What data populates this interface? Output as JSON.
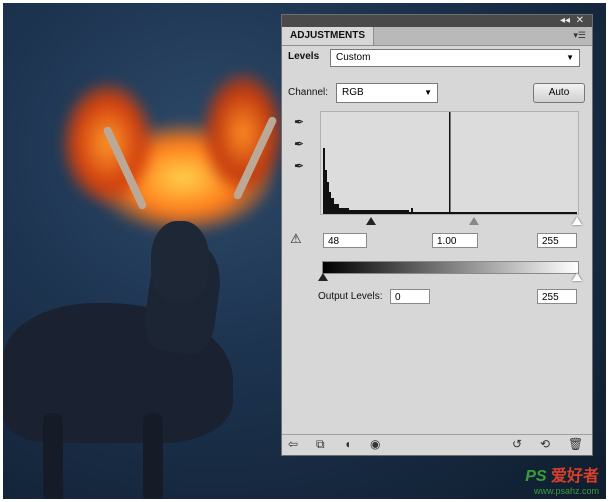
{
  "panel": {
    "tab_label": "ADJUSTMENTS",
    "collapse_icon": "double-chevron-left-icon",
    "close_icon": "close-icon",
    "menu_icon": "panel-menu-icon",
    "preset_label": "Levels",
    "preset_value": "Custom",
    "channel_label": "Channel:",
    "channel_value": "RGB",
    "auto_button": "Auto",
    "input_levels": {
      "black": "48",
      "gamma": "1.00",
      "white": "255"
    },
    "output_label": "Output Levels:",
    "output_levels": {
      "black": "0",
      "white": "255"
    }
  },
  "watermark": {
    "ps": "PS",
    "site_cn": "爱好者",
    "url": "www.psahz.com"
  },
  "colors": {
    "panel_bg": "#d7d7d7",
    "header": "#4a4a4a",
    "watermark_green": "#3a9e3a"
  }
}
